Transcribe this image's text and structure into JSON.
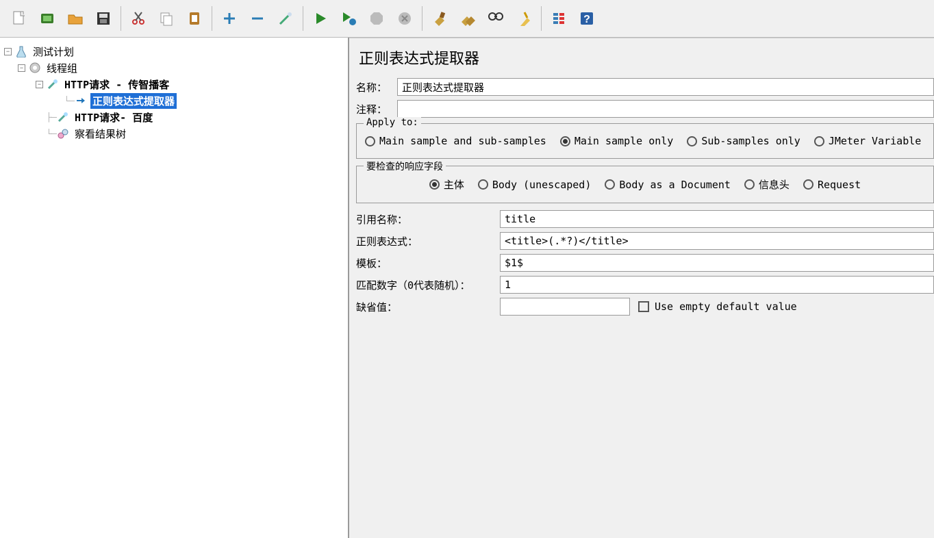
{
  "toolbar": {
    "icons": [
      "new",
      "templates",
      "open",
      "save",
      "cut",
      "copy",
      "paste",
      "plus",
      "minus",
      "wand",
      "run",
      "run-current",
      "stop-thread",
      "shutdown",
      "clear",
      "clear-all",
      "search",
      "broom",
      "toggle",
      "help"
    ]
  },
  "tree": {
    "root": {
      "label": "测试计划"
    },
    "thread_group": {
      "label": "线程组"
    },
    "http1": {
      "label": "HTTP请求 - 传智播客"
    },
    "regex": {
      "label": "正则表达式提取器"
    },
    "http2": {
      "label": "HTTP请求- 百度"
    },
    "results": {
      "label": "察看结果树"
    }
  },
  "panel": {
    "title": "正则表达式提取器",
    "name_label": "名称：",
    "name_value": "正则表达式提取器",
    "comment_label": "注释：",
    "comment_value": ""
  },
  "apply_to": {
    "title": "Apply to:",
    "opts": [
      "Main sample and sub-samples",
      "Main sample only",
      "Sub-samples only",
      "JMeter Variable"
    ],
    "selected": 1
  },
  "field_to_check": {
    "title": "要检查的响应字段",
    "opts": [
      "主体",
      "Body (unescaped)",
      "Body as a Document",
      "信息头",
      "Request"
    ],
    "selected": 0
  },
  "form": {
    "ref_name_label": "引用名称：",
    "ref_name_value": "title",
    "regex_label": "正则表达式：",
    "regex_value": "<title>(.*?)</title>",
    "template_label": "模板：",
    "template_value": "$1$",
    "match_no_label": "匹配数字（0代表随机）：",
    "match_no_value": "1",
    "default_label": "缺省值：",
    "default_value": "",
    "empty_default_label": "Use empty default value"
  }
}
